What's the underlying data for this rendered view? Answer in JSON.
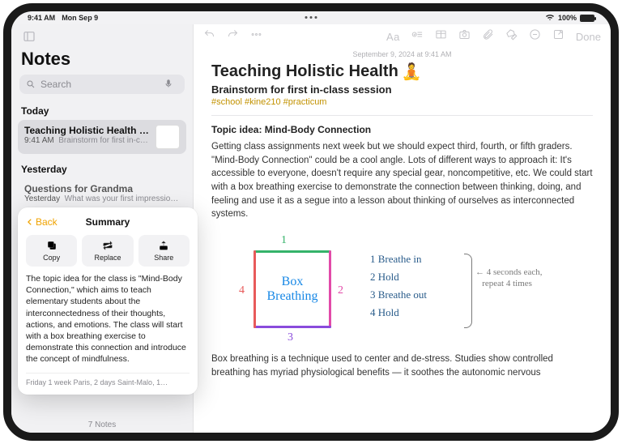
{
  "status": {
    "time": "9:41 AM",
    "date": "Mon Sep 9",
    "battery_pct": "100%"
  },
  "sidebar": {
    "title": "Notes",
    "search_placeholder": "Search",
    "sections": {
      "today": "Today",
      "yesterday": "Yesterday"
    },
    "notes": [
      {
        "title": "Teaching Holistic Health 🧘",
        "time": "9:41 AM",
        "preview": "Brainstorm for first in-cla…",
        "selected": true,
        "has_thumb": true
      },
      {
        "title": "Questions for Grandma",
        "time": "Yesterday",
        "preview": "What was your first impression…",
        "selected": false,
        "has_thumb": false
      }
    ],
    "footer_count": "7 Notes"
  },
  "popover": {
    "back": "Back",
    "title": "Summary",
    "actions": {
      "copy": "Copy",
      "replace": "Replace",
      "share": "Share"
    },
    "body": "The topic idea for the class is \"Mind-Body Connection,\" which aims to teach elementary students about the interconnectedness of their thoughts, actions, and emotions. The class will start with a box breathing exercise to demonstrate this connection and introduce the concept of mindfulness.",
    "tail": "Friday  1 week Paris, 2 days Saint-Malo, 1…"
  },
  "toolbar": {
    "done": "Done",
    "aa": "Aa"
  },
  "doc": {
    "datestamp": "September 9, 2024 at 9:41 AM",
    "title": "Teaching Holistic Health",
    "title_emoji": "🧘",
    "subtitle": "Brainstorm for first in-class session",
    "tags": "#school #kine210 #practicum",
    "topic": "Topic idea: Mind-Body Connection",
    "p1": "Getting class assignments next week but we should expect third, fourth, or fifth graders. \"Mind-Body Connection\" could be a cool angle. Lots of different ways to approach it: It's accessible to everyone, doesn't require any special gear, noncompetitive, etc. We could start with a box breathing exercise to demonstrate the connection between thinking, doing, and feeling and use it as a segue into a lesson about thinking of ourselves as interconnected systems.",
    "p2": "Box breathing is a technique used to center and de-stress. Studies show controlled breathing has myriad physiological benefits — it soothes the autonomic nervous",
    "diagram": {
      "box_label": "Box\nBreathing",
      "edges": [
        "1",
        "2",
        "3",
        "4"
      ],
      "steps": [
        "1  Breathe in",
        "2  Hold",
        "3  Breathe out",
        "4  Hold"
      ],
      "caption": "4 seconds each,\nrepeat 4 times"
    }
  }
}
